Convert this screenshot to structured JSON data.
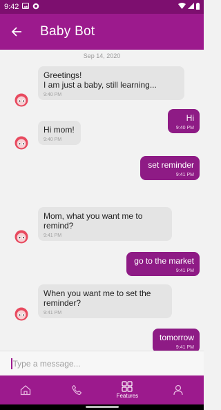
{
  "status_bar": {
    "time": "9:42"
  },
  "header": {
    "title": "Baby Bot"
  },
  "chat": {
    "date": "Sep 14, 2020",
    "messages": [
      {
        "from": "bot",
        "text": "Greetings!\nI am just a baby, still learning...",
        "time": "9:40 PM"
      },
      {
        "from": "user",
        "text": "Hi",
        "time": "9:40 PM"
      },
      {
        "from": "bot",
        "text": "Hi mom!",
        "time": "9:40 PM"
      },
      {
        "from": "user",
        "text": "set reminder",
        "time": "9:41 PM"
      },
      {
        "from": "bot",
        "text": "Mom, what you want me to remind?",
        "time": "9:41 PM"
      },
      {
        "from": "user",
        "text": "go to the market",
        "time": "9:41 PM"
      },
      {
        "from": "bot",
        "text": "When you want me to set the reminder?",
        "time": "9:41 PM"
      },
      {
        "from": "user",
        "text": "tomorrow",
        "time": "9:41 PM"
      }
    ]
  },
  "composer": {
    "placeholder": "Type a message..."
  },
  "bottom_nav": {
    "items": [
      {
        "icon": "home-icon",
        "label": ""
      },
      {
        "icon": "phone-icon",
        "label": ""
      },
      {
        "icon": "grid-icon",
        "label": "Features"
      },
      {
        "icon": "person-icon",
        "label": ""
      }
    ]
  },
  "colors": {
    "primary": "#9c1a8d",
    "status_bar": "#7d0f6f",
    "bubble_in": "#e4e4e4",
    "bubble_out": "#8e1b85"
  }
}
